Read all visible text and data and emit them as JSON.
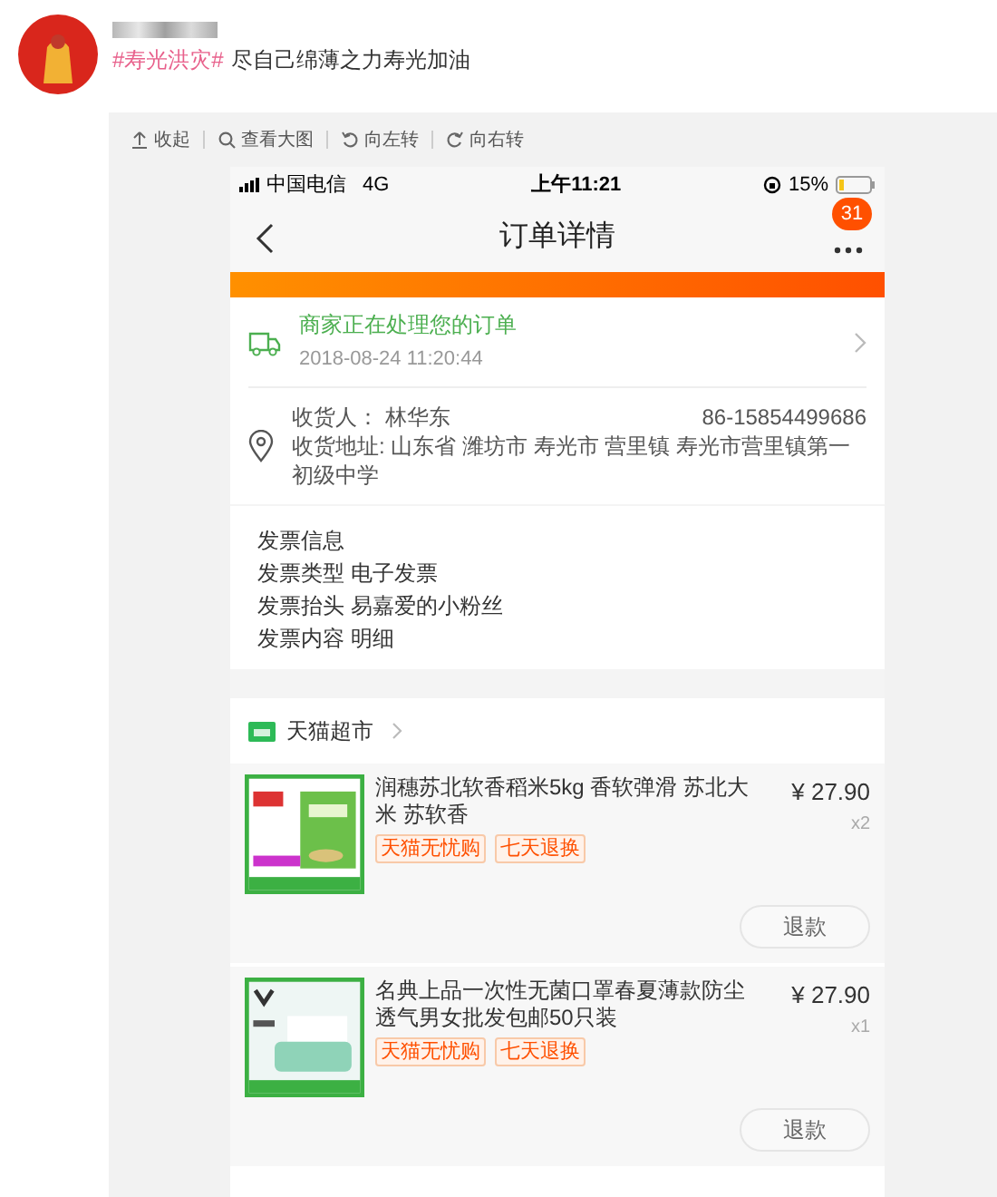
{
  "post": {
    "hashtag": "#寿光洪灾#",
    "text": "尽自己绵薄之力寿光加油"
  },
  "toolbar": [
    {
      "kind": "collapse",
      "label": "收起"
    },
    {
      "kind": "zoom",
      "label": "查看大图"
    },
    {
      "kind": "rotate_left",
      "label": "向左转"
    },
    {
      "kind": "rotate_right",
      "label": "向右转"
    }
  ],
  "phone_status": {
    "carrier": "中国电信",
    "network": "4G",
    "time": "上午11:21",
    "battery": "15%"
  },
  "nav": {
    "title": "订单详情",
    "badge": "31"
  },
  "order_status": {
    "text": "商家正在处理您的订单",
    "time": "2018-08-24 11:20:44"
  },
  "address": {
    "recipient": "收货人： 林华东",
    "phone": "86-15854499686",
    "address": "收货地址: 山东省 潍坊市 寿光市 营里镇 寿光市营里镇第一初级中学"
  },
  "invoice": [
    "发票信息",
    "发票类型 电子发票",
    "发票抬头 易嘉爱的小粉丝",
    "发票内容 明细"
  ],
  "store": {
    "name": "天猫超市"
  },
  "items": [
    {
      "title": "润穗苏北软香稻米5kg 香软弹滑 苏北大米 苏软香",
      "price": "¥ 27.90",
      "qty": "x2",
      "tags": [
        "天猫无忧购",
        "七天退换"
      ],
      "button": "退款"
    },
    {
      "title": "名典上品一次性无菌口罩春夏薄款防尘透气男女批发包邮50只装",
      "price": "¥ 27.90",
      "qty": "x1",
      "tags": [
        "天猫无忧购",
        "七天退换"
      ],
      "button": "退款"
    }
  ]
}
